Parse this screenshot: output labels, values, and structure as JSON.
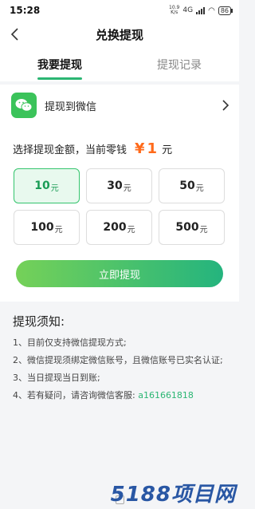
{
  "status_bar": {
    "time": "15:28",
    "net_speed_value": "10.9",
    "net_speed_unit": "K/s",
    "network": "4G",
    "battery": "86"
  },
  "nav": {
    "title": "兑换提现"
  },
  "tabs": [
    {
      "label": "我要提现",
      "active": true
    },
    {
      "label": "提现记录",
      "active": false
    }
  ],
  "wechat_row": {
    "label": "提现到微信",
    "icon": "wechat-icon"
  },
  "amount": {
    "prefix": "选择提现金额，当前零钱",
    "currency": "¥",
    "value": "1",
    "unit": "元"
  },
  "options": [
    {
      "value": "10",
      "unit": "元",
      "selected": true
    },
    {
      "value": "30",
      "unit": "元",
      "selected": false
    },
    {
      "value": "50",
      "unit": "元",
      "selected": false
    },
    {
      "value": "100",
      "unit": "元",
      "selected": false
    },
    {
      "value": "200",
      "unit": "元",
      "selected": false
    },
    {
      "value": "500",
      "unit": "元",
      "selected": false
    }
  ],
  "withdraw_button": {
    "label": "立即提现"
  },
  "notice": {
    "title": "提现须知:",
    "items": [
      "1、目前仅支持微信提现方式;",
      "2、微信提现须绑定微信账号，且微信账号已实名认证;",
      "3、当日提现当日到账;",
      "4、若有疑问，请咨询微信客服: "
    ],
    "service_id": "a161661818"
  },
  "watermark": {
    "text": "5188项目网"
  },
  "colors": {
    "accent": "#2bb673",
    "amount": "#ff6a1a",
    "button_start": "#75d158",
    "button_end": "#24b47e",
    "selected_bg": "#e8f9ee"
  }
}
